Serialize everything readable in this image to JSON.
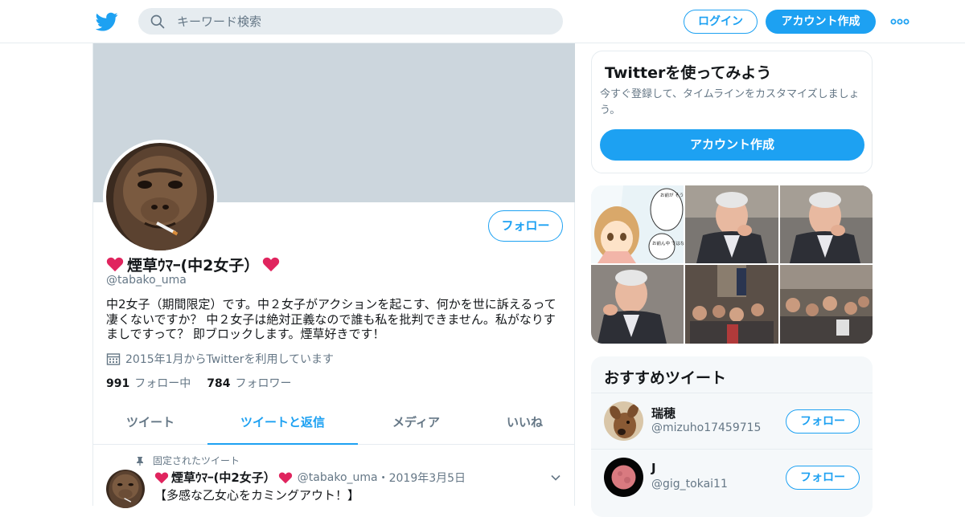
{
  "header": {
    "search_placeholder": "キーワード検索",
    "login_label": "ログイン",
    "signup_label": "アカウント作成"
  },
  "profile": {
    "display_name": "煙草ｳﾏｰ(中2女子）",
    "handle": "@tabako_uma",
    "follow_label": "フォロー",
    "bio": "中2女子（期間限定）です。中２女子がアクションを起こす、何かを世に訴えるって凄くないですか？ 中２女子は絶対正義なので誰も私を批判できません。私がなりすましですって？ 即ブロックします。煙草好きです！",
    "joined": "2015年1月からTwitterを利用しています",
    "following_count": "991",
    "following_label": "フォロー中",
    "followers_count": "784",
    "followers_label": "フォロワー"
  },
  "tabs": [
    {
      "label": "ツイート"
    },
    {
      "label": "ツイートと返信"
    },
    {
      "label": "メディア"
    },
    {
      "label": "いいね"
    }
  ],
  "pinned_tweet": {
    "pinned_label": "固定されたツイート",
    "name": "煙草ｳﾏｰ(中2女子）",
    "handle": "@tabako_uma",
    "separator": "・",
    "date": "2019年3月5日",
    "text": "【多感な乙女心をカミングアウト！】"
  },
  "sidebar": {
    "title": "Twitterを使ってみよう",
    "subtitle": "今すぐ登録して、タイムラインをカスタマイズしましょう。",
    "signup_label": "アカウント作成"
  },
  "manga_text": {
    "bubble1": "お前が そう思うんなら そうなんだろう",
    "bubble2": "お前ん中 ではな"
  },
  "recommended": {
    "title": "おすすめツイート",
    "follow_label": "フォロー",
    "users": [
      {
        "name": "瑞穂",
        "handle": "@mizuho17459715"
      },
      {
        "name": "J",
        "handle": "@gig_tokai11"
      }
    ]
  },
  "colors": {
    "accent": "#1da1f2",
    "banner": "#ccd6dd",
    "heart": "#e0245e"
  }
}
